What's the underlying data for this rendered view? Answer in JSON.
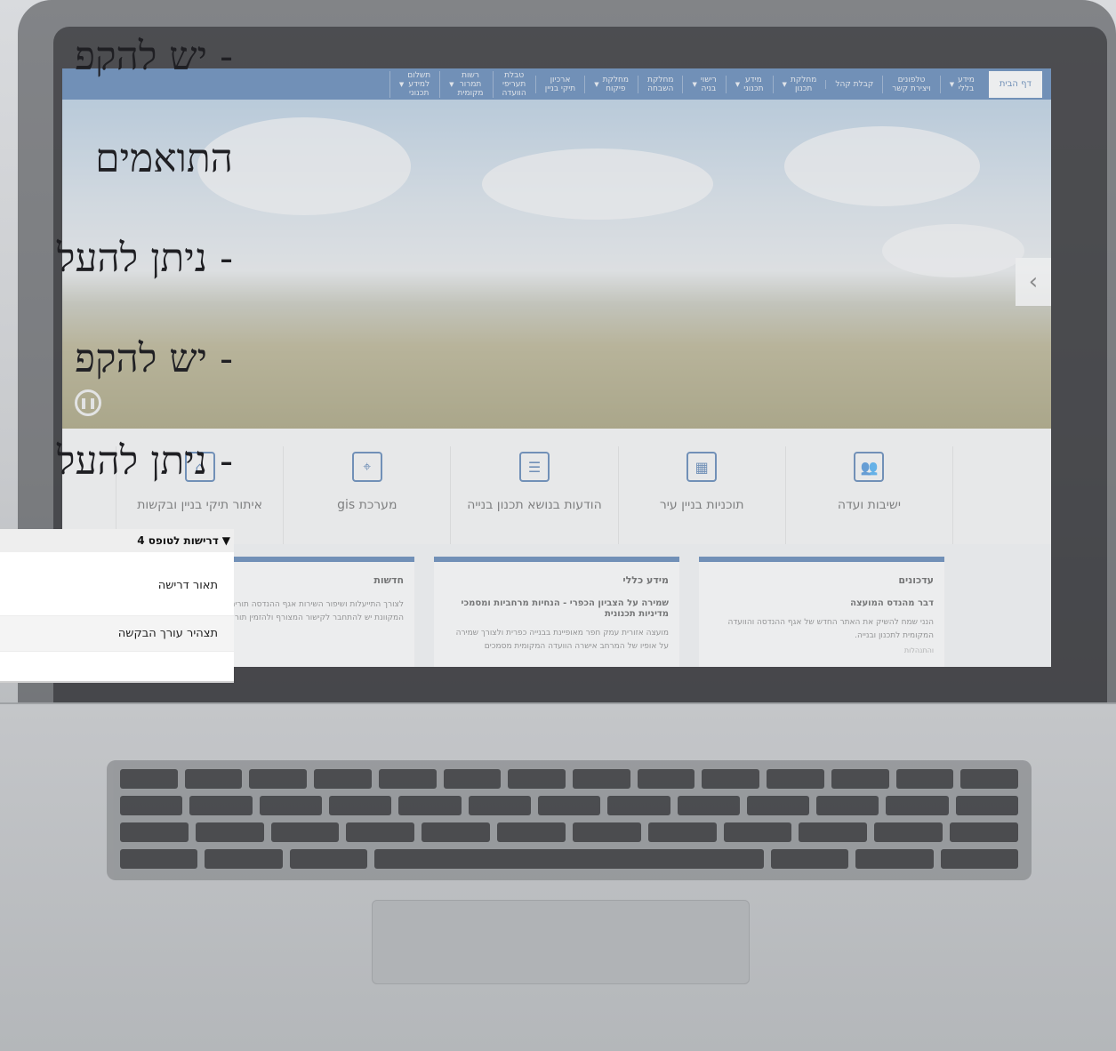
{
  "nav": {
    "home": "דף הבית",
    "items": [
      {
        "label": "מידע\nבללי",
        "caret": true
      },
      {
        "label": "טלפונים\nויצירת קשר",
        "caret": false
      },
      {
        "label": "קבלת קהל",
        "caret": false
      },
      {
        "label": "מחלקת\nתכנון",
        "caret": true
      },
      {
        "label": "מידע\nתכנוני",
        "caret": true
      },
      {
        "label": "רישוי\nבניה",
        "caret": true
      },
      {
        "label": "מחלקת\nהשבחה",
        "caret": false
      },
      {
        "label": "מחלקת\nפיקוח",
        "caret": true
      },
      {
        "label": "ארכיון\nתיקי בניין",
        "caret": false
      },
      {
        "label": "טבלת\nתעריפי\nהוועדה",
        "caret": false
      },
      {
        "label": "רשות\nתמרור\nמקומית",
        "caret": true
      },
      {
        "label": "תשלום\nלמידע\nתכנוני",
        "caret": true
      }
    ]
  },
  "hero": {
    "next_arrow": "›",
    "pause_icon": "❚❚"
  },
  "quick_links": [
    {
      "label": "ישיבות ועדה",
      "icon": "people-icon",
      "glyph": "👥"
    },
    {
      "label": "תוכניות בניין עיר",
      "icon": "map-book-icon",
      "glyph": "▦"
    },
    {
      "label": "הודעות בנושא תכנון בנייה",
      "icon": "document-icon",
      "glyph": "☰"
    },
    {
      "label": "מערכת gis",
      "icon": "map-pin-icon",
      "glyph": "⌖"
    },
    {
      "label": "איתור תיקי בניין ובקשות",
      "icon": "house-icon",
      "glyph": "⌂"
    }
  ],
  "panels": [
    {
      "heading": "עדכונים",
      "subheading": "דבר מהנדס המועצה",
      "text": "הנני שמח להשיק את האתר החדש של אגף ההנדסה והוועדה המקומית לתכנון ובנייה.",
      "more": "והתנהלות"
    },
    {
      "heading": "מידע כללי",
      "subheading": "שמירה על הצביון הכפרי - הנחיות מרחביות ומסמכי מדיניות תכנונית",
      "text": "מועצה אזורית עמק חפר מאופיינת בבנייה כפרית ולצורך שמירה על אופיו של המרחב אישרה הוועדה המקומית מסמכים",
      "more": ""
    },
    {
      "heading": "חדשות",
      "subheading": "",
      "text": "לצורך התייעלות ושיפור השירות אגף ההנדסה תורים בשיטה המקוונת יש להתחבר לקישור המצורף ולהזמין תור לנוח",
      "more": ""
    }
  ],
  "overlay_lines": [
    "יש להקפ",
    "התואמים",
    "ניתן להעל",
    "יש להקפ",
    "ניתן להעל"
  ],
  "overlay_dashes": [
    "-",
    "",
    "-",
    "-",
    "-"
  ],
  "requirements": {
    "title": "דרישות לטופס 4",
    "rows": [
      "תאור דרישה",
      "תצהיר עורך הבקשה"
    ]
  },
  "colors": {
    "brand": "#2b5fa0",
    "overlay_text": "#1f1f23"
  }
}
